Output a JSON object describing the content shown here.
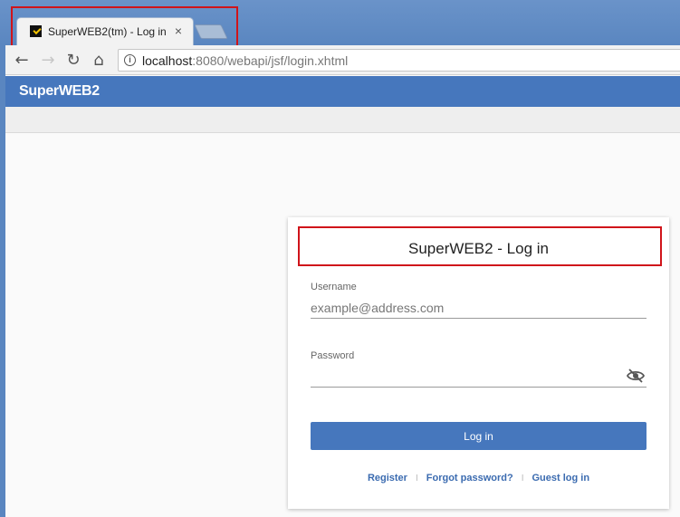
{
  "browser": {
    "tab_title": "SuperWEB2(tm) - Log in",
    "tab_close": "×",
    "url_host": "localhost",
    "url_rest": ":8080/webapi/jsf/login.xhtml"
  },
  "toolbar": {
    "back_glyph": "←",
    "forward_glyph": "→",
    "reload_glyph": "↻",
    "home_glyph": "⌂",
    "info_glyph": "i"
  },
  "app": {
    "title": "SuperWEB2"
  },
  "login": {
    "title": "SuperWEB2 - Log in",
    "username_label": "Username",
    "username_placeholder": "example@address.com",
    "username_value": "",
    "password_label": "Password",
    "password_value": "",
    "submit_label": "Log in",
    "links": {
      "register": "Register",
      "forgot_password": "Forgot password?",
      "guest": "Guest log in",
      "separator": "I"
    }
  },
  "colors": {
    "brand": "#4677bd",
    "highlight": "#d0141a",
    "link": "#3b6bb0"
  }
}
